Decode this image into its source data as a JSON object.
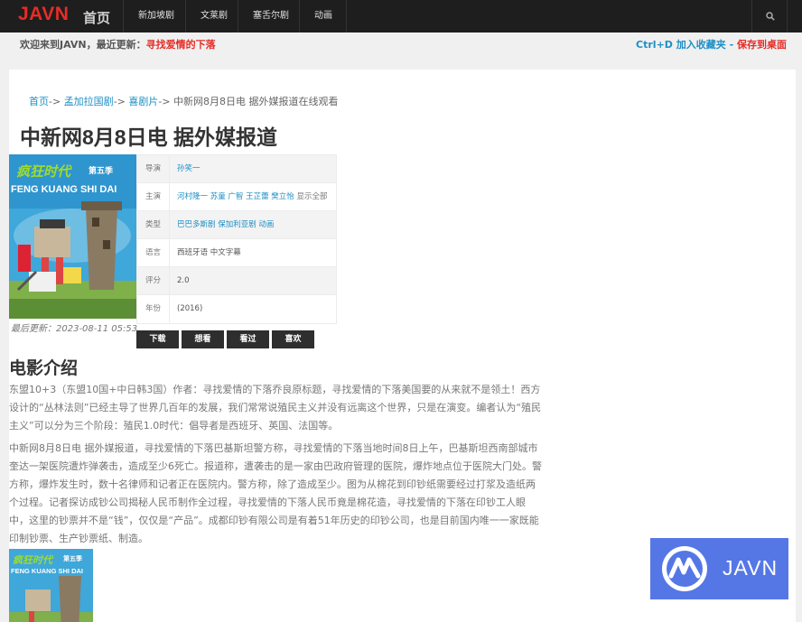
{
  "navbar": {
    "logo": "JAVN",
    "home": "首页",
    "items": [
      "新加坡剧",
      "文莱剧",
      "塞舌尔剧",
      "动画"
    ]
  },
  "notice": {
    "prefix": "欢迎来到JAVN，最近更新：",
    "latest": "寻找爱情的下落"
  },
  "bookmark": {
    "shortcut": "Ctrl+D 加入收藏夹",
    "sep": " - ",
    "desktop": "保存到桌面"
  },
  "breadcrumb": {
    "home": "首页",
    "level1": "孟加拉国剧",
    "level2": "喜剧片",
    "sep": "->",
    "current": "中新网8月8日电 据外媒报道在线观看"
  },
  "title": "中新网8月8日电 据外媒报道",
  "poster": {
    "title_cn": "疯狂时代",
    "season": "第五季",
    "title_en": "FENG KUANG SHI DAI"
  },
  "updated": "最后更新：2023-08-11 05:53",
  "info": {
    "director_label": "导演",
    "director": "孙笑一",
    "cast_label": "主演",
    "cast": "河村隆一 苏童 广智 王芷蕾 樊立怡",
    "cast_more": "显示全部",
    "genre_label": "类型",
    "genre": "巴巴多斯剧 保加利亚剧 动画",
    "language_label": "语言",
    "language": "西班牙语 中文字幕",
    "rating_label": "评分",
    "rating": "2.0",
    "year_label": "年份",
    "year": "(2016)"
  },
  "buttons": {
    "download": "下载",
    "want": "想看",
    "watched": "看过",
    "like": "喜欢"
  },
  "intro": {
    "heading": "电影介绍",
    "p1": "东盟10+3（东盟10国+中日韩3国）作者：寻找爱情的下落乔良原标题，寻找爱情的下落美国要的从来就不是领土！西方设计的“丛林法则”已经主导了世界几百年的发展，我们常常说殖民主义并没有远离这个世界，只是在演变。编者认为“殖民主义”可以分为三个阶段：殖民1.0时代：倡导者是西班牙、英国、法国等。",
    "p2": "中新网8月8日电 据外媒报道，寻找爱情的下落巴基斯坦警方称，寻找爱情的下落当地时间8日上午，巴基斯坦西南部城市奎达一架医院遭炸弹袭击，造成至少6死亡。报道称，遭袭击的是一家由巴政府管理的医院，爆炸地点位于医院大门处。警方称，爆炸发生时，数十名律师和记者正在医院内。警方称，除了造成至少。图为从棉花到印钞纸需要经过打浆及造纸两个过程。记者探访成钞公司揭秘人民币制作全过程，寻找爱情的下落人民币竟是棉花造，寻找爱情的下落在印钞工人眼中，这里的钞票并不是“钱”，仅仅是“产品”。成都印钞有限公司是有着51年历史的印钞公司，也是目前国内唯一一家既能印制钞票、生产钞票纸、制造。"
  },
  "badge": {
    "text": "JAVN"
  },
  "colors": {
    "accent_red": "#e52d27",
    "link_blue": "#1e8fc4",
    "badge_blue": "#5577e6",
    "navbar": "#1e1e1e"
  }
}
